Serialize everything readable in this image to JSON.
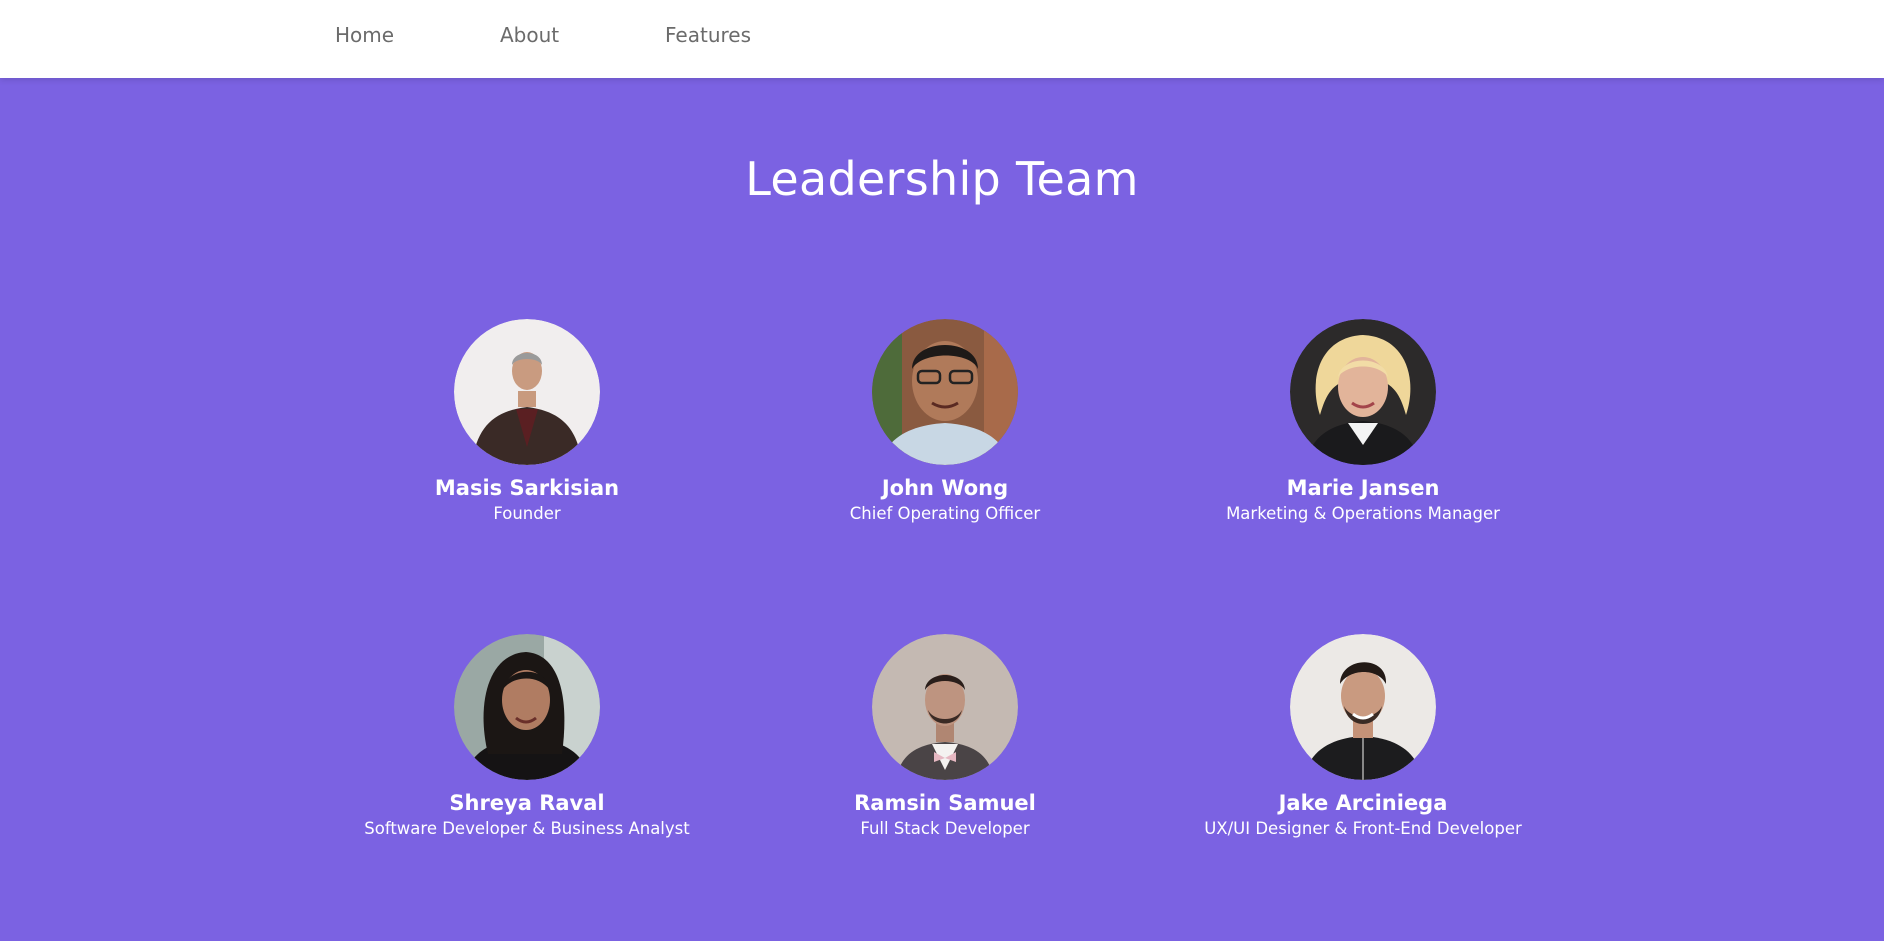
{
  "nav": {
    "items": [
      {
        "label": "Home"
      },
      {
        "label": "About"
      },
      {
        "label": "Features"
      }
    ]
  },
  "section": {
    "title": "Leadership Team"
  },
  "team": [
    {
      "name": "Masis Sarkisian",
      "role": "Founder",
      "avatar": "portrait-photo"
    },
    {
      "name": "John Wong",
      "role": "Chief Operating Officer",
      "avatar": "portrait-photo"
    },
    {
      "name": "Marie Jansen",
      "role": "Marketing & Operations Manager",
      "avatar": "portrait-photo"
    },
    {
      "name": "Shreya Raval",
      "role": "Software Developer & Business Analyst",
      "avatar": "portrait-photo"
    },
    {
      "name": "Ramsin Samuel",
      "role": "Full Stack Developer",
      "avatar": "portrait-photo"
    },
    {
      "name": "Jake Arciniega",
      "role": "UX/UI Designer & Front-End Developer",
      "avatar": "portrait-photo"
    }
  ],
  "colors": {
    "background": "#7b62e2",
    "nav_background": "#ffffff",
    "nav_text": "#6b6b6b",
    "text": "#ffffff"
  }
}
